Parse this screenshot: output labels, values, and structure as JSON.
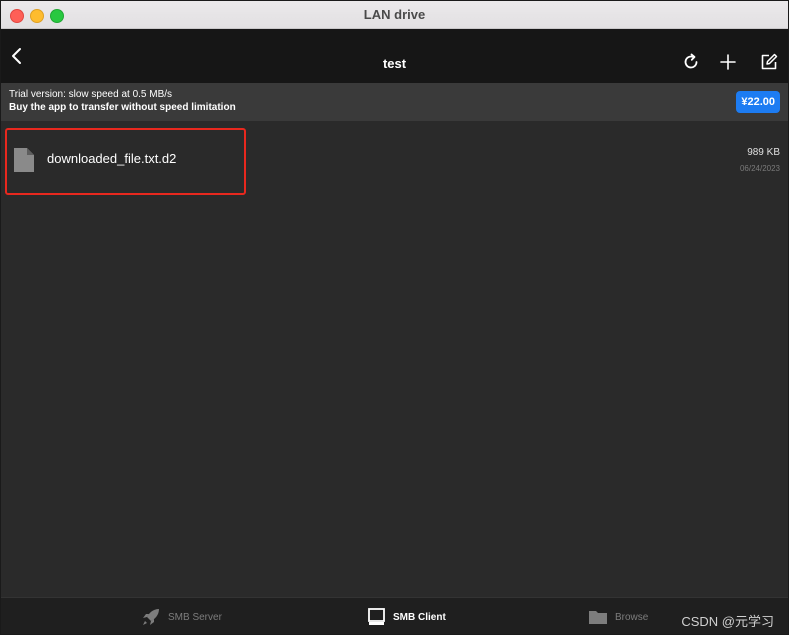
{
  "window": {
    "title": "LAN drive"
  },
  "navbar": {
    "title": "test",
    "icons": [
      "back-icon",
      "refresh-icon",
      "plus-icon",
      "edit-icon"
    ]
  },
  "banner": {
    "line1": "Trial version: slow speed at 0.5 MB/s",
    "line2": "Buy the app to transfer without speed limitation",
    "price": "¥22.00"
  },
  "files": [
    {
      "name": "downloaded_file.txt.d2",
      "size": "989 KB",
      "date": "06/24/2023",
      "icon": "file-icon"
    }
  ],
  "tabs": [
    {
      "label": "SMB Server",
      "icon": "rocket-icon",
      "active": false
    },
    {
      "label": "SMB Client",
      "icon": "monitor-icon",
      "active": true
    },
    {
      "label": "Browse",
      "icon": "folder-icon",
      "active": false
    }
  ],
  "watermark": "CSDN @元学习",
  "colors": {
    "accent": "#1d7cf2",
    "highlight": "#e8281e",
    "background": "#2a2a2a"
  }
}
